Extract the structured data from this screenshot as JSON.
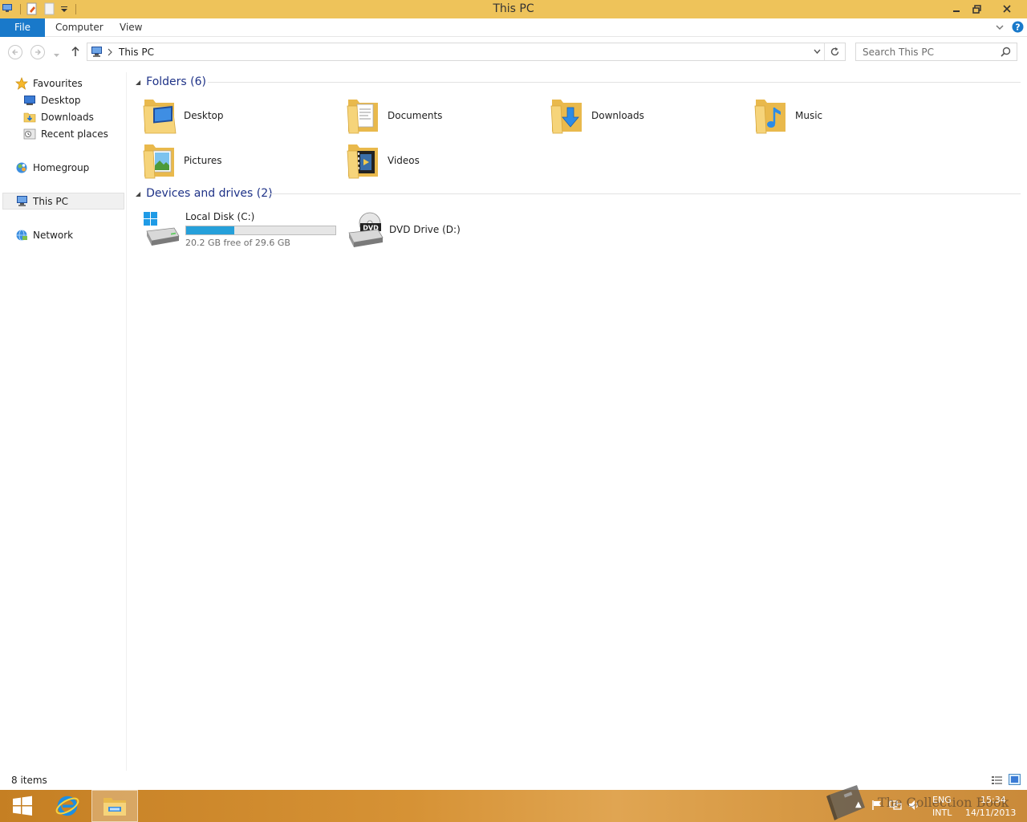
{
  "window": {
    "title": "This PC"
  },
  "ribbon": {
    "tabs": [
      "File",
      "Computer",
      "View"
    ]
  },
  "address": {
    "location": "This PC",
    "search_placeholder": "Search This PC"
  },
  "nav": {
    "favourites": "Favourites",
    "desktop": "Desktop",
    "downloads": "Downloads",
    "recent_places": "Recent places",
    "homegroup": "Homegroup",
    "this_pc": "This PC",
    "network": "Network"
  },
  "content": {
    "folders_header": "Folders (6)",
    "folders": [
      "Desktop",
      "Documents",
      "Downloads",
      "Music",
      "Pictures",
      "Videos"
    ],
    "drives_header": "Devices and drives (2)",
    "drives": [
      {
        "name": "Local Disk (C:)",
        "free_text": "20.2 GB free of 29.6 GB",
        "used_fraction": 0.32
      },
      {
        "name": "DVD Drive (D:)",
        "badge": "DVD"
      }
    ]
  },
  "status": {
    "items": "8 items"
  },
  "taskbar": {
    "lang_top": "ENG",
    "lang_bottom": "INTL",
    "time": "15:34",
    "date": "14/11/2013",
    "watermark": "The Collection Book"
  },
  "colors": {
    "titlebar": "#eec35a",
    "file_tab": "#1979ca",
    "group_header": "#1e3287",
    "drive_fill": "#26a0da"
  }
}
